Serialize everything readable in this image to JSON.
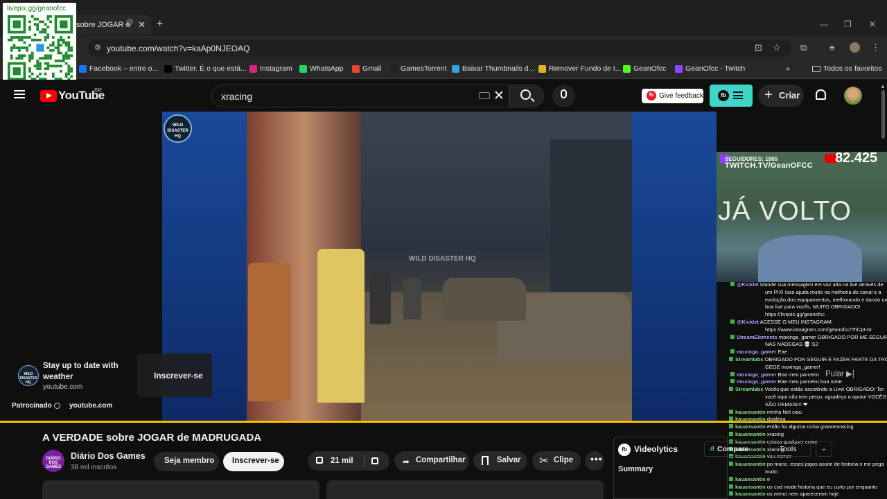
{
  "browser": {
    "tab_title": "sobre JOGAR d",
    "url": "youtube.com/watch?v=kaAp0NJEOAQ",
    "bookmarks": [
      {
        "label": "Facebook – entre o...",
        "icon": "facebook-icon",
        "color": "#1877f2"
      },
      {
        "label": "Twitter. É o que está...",
        "icon": "x-icon",
        "color": "#000000"
      },
      {
        "label": "Instagram",
        "icon": "instagram-icon",
        "color": "#d62976"
      },
      {
        "label": "WhatsApp",
        "icon": "whatsapp-icon",
        "color": "#25d366"
      },
      {
        "label": "Gmail",
        "icon": "gmail-icon",
        "color": "#ea4335"
      },
      {
        "label": "GamesTorrent",
        "icon": "gamestorrent-icon",
        "color": "#222222"
      },
      {
        "label": "Baixar Thumbnails d...",
        "icon": "thumbnails-icon",
        "color": "#2aa7e0"
      },
      {
        "label": "Remover Fundo de I...",
        "icon": "removebg-icon",
        "color": "#e0b21f"
      },
      {
        "label": "GeanOfcc",
        "icon": "kick-icon",
        "color": "#53fc18"
      },
      {
        "label": "GeanOfcc - Twitch",
        "icon": "twitch-icon",
        "color": "#9146ff"
      }
    ],
    "all_bookmarks": "Todos os favoritos"
  },
  "qr_overlay": {
    "label": "livepix.gg/geanofcc"
  },
  "youtube": {
    "logo_text": "YouTube",
    "region": "BR",
    "search_query": "xracing",
    "feedback_label": "Give feedback",
    "create_label": "Criar"
  },
  "video": {
    "channel_logo_text": "WILD DISASTER HQ",
    "watermark": "WILD DISASTER HQ"
  },
  "ad": {
    "title": "Stay up to date with weather",
    "domain": "youtube.com",
    "subscribe_label": "Inscrever-se",
    "sponsored_label": "Patrocinado",
    "sponsored_domain": "youtube.com",
    "progress": 1.0
  },
  "twitch_overlay": {
    "followers": "SEGUIDORES: 1865",
    "channel_url": "TWITCH.TV/GeanOFCC",
    "count": "82.425",
    "message": "JÁ VOLTO"
  },
  "chat": [
    {
      "user": "@Kicklet",
      "text": "Mande sua mensagem em voz alta na live através de",
      "type": "p"
    },
    {
      "user": "",
      "text": "um PIX! Isso ajuda muito na melhoria do canal e a",
      "type": "c"
    },
    {
      "user": "",
      "text": "evolução dos equipamentos, melhorando e dando uma",
      "type": "c"
    },
    {
      "user": "",
      "text": "boa live para vocês, MUITO OBRIGADO!",
      "type": "c"
    },
    {
      "user": "",
      "text": "https://livepix.gg/geanofcc",
      "type": "c"
    },
    {
      "user": "@Kicklet",
      "text": "ACESSE O MEU INSTAGRAM:",
      "type": "p"
    },
    {
      "user": "",
      "text": "https://www.instagram.com/geanofcc/?hl=pt-br",
      "type": "c"
    },
    {
      "user": "StreamElements",
      "text": "moxinga_gamer OBRIGADO POR ME SEGUIR, BEIJOS",
      "type": "p"
    },
    {
      "user": "",
      "text": "NAS NADEGAS 💀 S2",
      "type": "c"
    },
    {
      "user": "moxinga_gamer",
      "text": "Eae",
      "type": "p"
    },
    {
      "user": "Streamlabs",
      "text": "OBRIGADO POR SEGUIR E FAZER PARTE DA TROPA DO",
      "type": "g"
    },
    {
      "user": "",
      "text": "GEGE moxinga_gamer!",
      "type": "c"
    },
    {
      "user": "moxinga_gamer",
      "text": "Boa meu parceiro",
      "type": "p"
    },
    {
      "user": "moxinga_gamer",
      "text": "Eae meu parceiro boa noite",
      "type": "p"
    },
    {
      "user": "Streamlabs",
      "text": "Vocês que estão assistindo a Live! OBRIGADO! Ter",
      "type": "g"
    },
    {
      "user": "",
      "text": "você aqui não tem preço, agradeço o apoio! VOCÊS",
      "type": "c"
    },
    {
      "user": "",
      "text": "SÃO DEMAIS!!! ❤",
      "type": "c"
    },
    {
      "user": "kauansantin",
      "text": "minha Net caiu",
      "type": "g"
    },
    {
      "user": "kauansantin",
      "text": "doideira",
      "type": "g"
    },
    {
      "user": "kauansantin",
      "text": "então foi alguma coisa granoexracing",
      "type": "g"
    },
    {
      "user": "kauansantin",
      "text": "xracing",
      "type": "g"
    },
    {
      "user": "kauansantin",
      "text": "coloca qualquer coisa",
      "type": "g"
    },
    {
      "user": "kauansantin",
      "text": "xracing",
      "type": "g"
    },
    {
      "user": "kauansantin",
      "text": "vou comer",
      "type": "g"
    },
    {
      "user": "kauansantin",
      "text": "po mano, esses jogos assim de historia n me pega",
      "type": "g"
    },
    {
      "user": "",
      "text": "muito",
      "type": "c"
    },
    {
      "user": "kauansantin",
      "text": "e",
      "type": "g"
    },
    {
      "user": "kauansantin",
      "text": "os cod mode historia que eu curto por enquanto",
      "type": "g"
    },
    {
      "user": "kauansantin",
      "text": "os meno nem apareceram hoje",
      "type": "g"
    }
  ],
  "skip_label": "Pular",
  "watch": {
    "title": "A VERDADE sobre JOGAR de MADRUGADA",
    "channel_name": "Diário Dos Games",
    "channel_avatar_text": "DIÁRIO DOS GAMES",
    "subscribers": "38 mil inscritos",
    "member_label": "Seja membro",
    "subscribe_label": "Inscrever-se",
    "likes": "21 mil",
    "share_label": "Compartilhar",
    "save_label": "Salvar",
    "clip_label": "Clipe"
  },
  "videolytics": {
    "title": "Videolytics",
    "summary_label": "Summary",
    "compare_label": "Compare",
    "tools_label": "Tools"
  }
}
